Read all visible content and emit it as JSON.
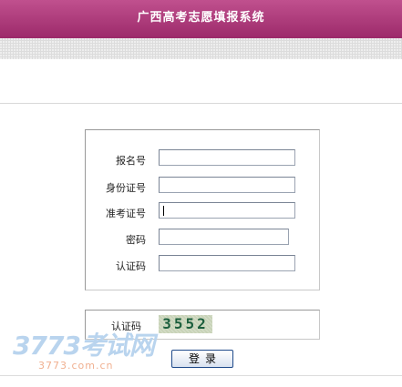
{
  "header": {
    "title": "广西高考志愿填报系统"
  },
  "form": {
    "fields": [
      {
        "label": "报名号",
        "value": ""
      },
      {
        "label": "身份证号",
        "value": ""
      },
      {
        "label": "准考证号",
        "value": ""
      },
      {
        "label": "密码",
        "value": ""
      },
      {
        "label": "认证码",
        "value": ""
      }
    ]
  },
  "captcha": {
    "label": "认证码",
    "code": "3552"
  },
  "login_button": {
    "label": "登录"
  },
  "watermark": {
    "main": "3773考试网",
    "sub": "3773.com.cn"
  },
  "colors": {
    "header": "#a8337a",
    "border": "#999999"
  }
}
